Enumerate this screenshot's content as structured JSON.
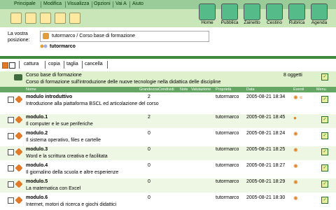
{
  "menubar": {
    "items": [
      "Principale",
      "Modifica",
      "Visualizza",
      "Opzioni",
      "Vai A",
      "Aiuto"
    ]
  },
  "toolbar": {
    "big_tools": [
      "Home",
      "Pubblica",
      "Zainetto",
      "Cestino",
      "Rubrica",
      "Agenda"
    ]
  },
  "location": {
    "label_line1": "La vostra",
    "label_line2": "posizione:",
    "path": "tutormarco / Corso base di formazione",
    "user": "tutormarco"
  },
  "actions": [
    "cattura",
    "copia",
    "taglia",
    "cancella"
  ],
  "folder": {
    "title": "Corso base di formazione",
    "count": "8 oggetti",
    "description": "Corso di formazione sull'introduzione delle nuove tecnologie nella didattica delle discipline"
  },
  "columns": {
    "nome": "Nome",
    "grandezza": "Grandezza",
    "condividi": "Condividi",
    "note": "Note",
    "valutazione": "Valutazione",
    "proprieta": "Proprietà",
    "data": "Data",
    "eventi": "Eventi",
    "menu": "Menu"
  },
  "rows": [
    {
      "name": "modulo introduttivo",
      "desc": "Introduzione alla piattaforma BSCL ed articolazione del corso",
      "num": "2",
      "owner": "tutormarco",
      "date": "2005-08-21 18:34",
      "events": "✺ ≈"
    },
    {
      "name": "modulo.1",
      "desc": "Il computer e le sue periferiche",
      "num": "2",
      "owner": "tutormarco",
      "date": "2005-08-21 18:45",
      "events": "●"
    },
    {
      "name": "modulo.2",
      "desc": "Il sistema operativo, files e cartelle",
      "num": "0",
      "owner": "tutormarco",
      "date": "2005-08-21 18:24",
      "events": "✺"
    },
    {
      "name": "modulo.3",
      "desc": "Word e la scrittura creativa e facilitata",
      "num": "0",
      "owner": "tutormarco",
      "date": "2005-08-21 18:25",
      "events": "✺"
    },
    {
      "name": "modulo.4",
      "desc": "Il giornalino della scuola e altre esperienze",
      "num": "0",
      "owner": "tutormarco",
      "date": "2005-08-21 18:27",
      "events": "✺"
    },
    {
      "name": "modulo.5",
      "desc": "La matematica con Excel",
      "num": "0",
      "owner": "tutormarco",
      "date": "2005-08-21 18:29",
      "events": "✺"
    },
    {
      "name": "modulo.6",
      "desc": "Internet, motori di ricerca e giochi didattici",
      "num": "0",
      "owner": "tutormarco",
      "date": "2005-08-21 18:30",
      "events": "✺"
    }
  ]
}
